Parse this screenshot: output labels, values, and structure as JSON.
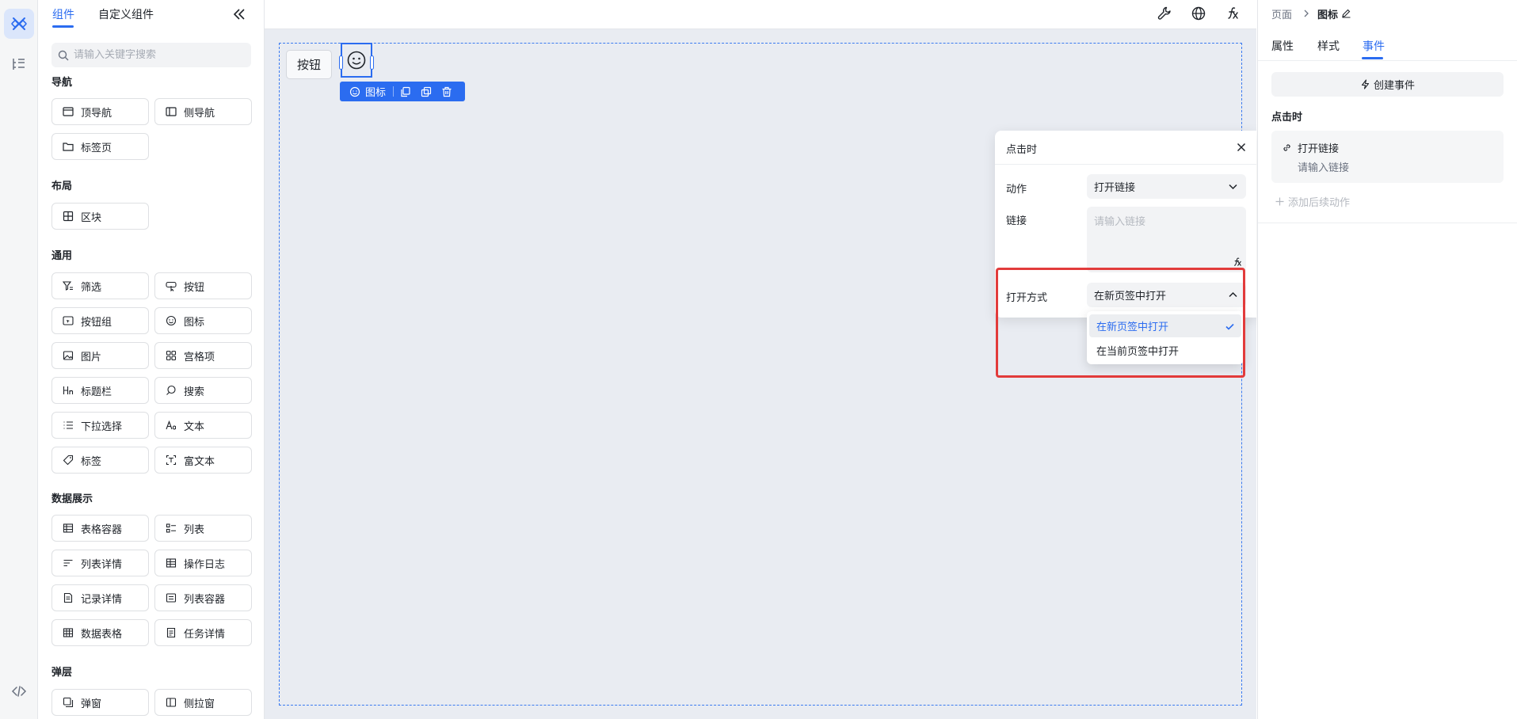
{
  "left_panel": {
    "tabs": [
      "组件",
      "自定义组件"
    ],
    "search_placeholder": "请输入关键字搜索",
    "sections": [
      {
        "title": "导航",
        "items": [
          {
            "label": "顶导航",
            "icon": "top-nav-icon"
          },
          {
            "label": "侧导航",
            "icon": "side-nav-icon"
          },
          {
            "label": "标签页",
            "icon": "folder-icon"
          }
        ]
      },
      {
        "title": "布局",
        "items": [
          {
            "label": "区块",
            "icon": "grid-block-icon"
          }
        ]
      },
      {
        "title": "通用",
        "items": [
          {
            "label": "筛选",
            "icon": "filter-icon"
          },
          {
            "label": "按钮",
            "icon": "pointer-button-icon"
          },
          {
            "label": "按钮组",
            "icon": "button-group-icon"
          },
          {
            "label": "图标",
            "icon": "smile-icon"
          },
          {
            "label": "图片",
            "icon": "image-icon"
          },
          {
            "label": "宫格项",
            "icon": "grid-icon"
          },
          {
            "label": "标题栏",
            "icon": "heading-icon"
          },
          {
            "label": "搜索",
            "icon": "search-icon"
          },
          {
            "label": "下拉选择",
            "icon": "list-icon"
          },
          {
            "label": "文本",
            "icon": "text-icon"
          },
          {
            "label": "标签",
            "icon": "tag-icon"
          },
          {
            "label": "富文本",
            "icon": "rich-text-icon"
          }
        ]
      },
      {
        "title": "数据展示",
        "items": [
          {
            "label": "表格容器",
            "icon": "table-icon"
          },
          {
            "label": "列表",
            "icon": "list-view-icon"
          },
          {
            "label": "列表详情",
            "icon": "list-detail-icon"
          },
          {
            "label": "操作日志",
            "icon": "log-icon"
          },
          {
            "label": "记录详情",
            "icon": "document-icon"
          },
          {
            "label": "列表容器",
            "icon": "list-container-icon"
          },
          {
            "label": "数据表格",
            "icon": "data-table-icon"
          },
          {
            "label": "任务详情",
            "icon": "task-icon"
          }
        ]
      },
      {
        "title": "弹层",
        "items": [
          {
            "label": "弹窗",
            "icon": "modal-icon"
          },
          {
            "label": "侧拉窗",
            "icon": "drawer-icon"
          }
        ]
      }
    ]
  },
  "canvas": {
    "button_label": "按钮",
    "selected_component_label": "图标"
  },
  "event_popup": {
    "title": "点击时",
    "action_label": "动作",
    "action_value": "打开链接",
    "link_label": "链接",
    "link_placeholder": "请输入链接",
    "open_mode_label": "打开方式",
    "open_mode_value": "在新页签中打开",
    "options": [
      "在新页签中打开",
      "在当前页签中打开"
    ]
  },
  "right_panel": {
    "breadcrumb": [
      "页面",
      "图标"
    ],
    "tabs": [
      "属性",
      "样式",
      "事件"
    ],
    "create_event_label": "创建事件",
    "event_trigger": "点击时",
    "event_action": "打开链接",
    "event_action_placeholder": "请输入链接",
    "add_followup_label": "添加后续动作"
  },
  "colors": {
    "accent": "#2b6cf0",
    "highlight_border": "#e23b3b"
  }
}
